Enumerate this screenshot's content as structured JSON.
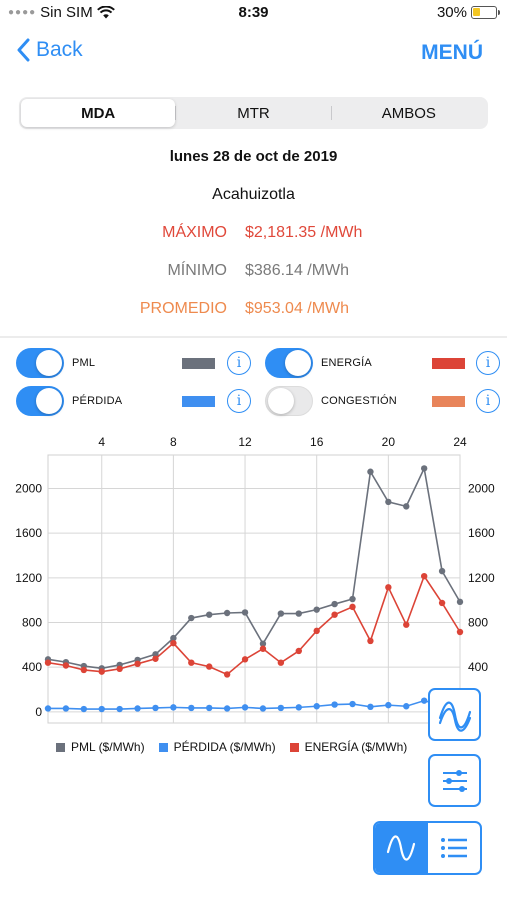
{
  "status_bar": {
    "carrier": "Sin SIM",
    "time": "8:39",
    "battery": "30%"
  },
  "nav": {
    "back_label": "Back",
    "menu_label": "MENÚ"
  },
  "segments": [
    {
      "label": "MDA",
      "active": true
    },
    {
      "label": "MTR",
      "active": false
    },
    {
      "label": "AMBOS",
      "active": false
    }
  ],
  "date": "lunes 28 de oct de 2019",
  "node": "Acahuizotla",
  "stats": {
    "max": {
      "label": "MÁXIMO",
      "value": "$2,181.35 /MWh"
    },
    "min": {
      "label": "MÍNIMO",
      "value": "$386.14 /MWh"
    },
    "avg": {
      "label": "PROMEDIO",
      "value": "$953.04 /MWh"
    }
  },
  "toggles": {
    "pml": {
      "label": "PML",
      "on": true,
      "color": "#6b717c"
    },
    "energia": {
      "label": "ENERGÍA",
      "on": true,
      "color": "#dc4437"
    },
    "perdida": {
      "label": "PÉRDIDA",
      "on": true,
      "color": "#3f8ff0"
    },
    "congestion": {
      "label": "CONGESTIÓN",
      "on": false,
      "color": "#e8845a"
    }
  },
  "icons": {
    "info": "info-icon",
    "wave_toggle": "wave-icon",
    "filters": "sliders-icon",
    "chart_mode": "wave-icon",
    "list_mode": "list-icon"
  },
  "chart_data": {
    "type": "line",
    "x": [
      1,
      2,
      3,
      4,
      5,
      6,
      7,
      8,
      9,
      10,
      11,
      12,
      13,
      14,
      15,
      16,
      17,
      18,
      19,
      20,
      21,
      22,
      23,
      24
    ],
    "x_ticks": [
      "4",
      "8",
      "12",
      "16",
      "20",
      "24"
    ],
    "y_ticks": [
      "0",
      "400",
      "800",
      "1200",
      "1600",
      "2000"
    ],
    "xlim": [
      1,
      24
    ],
    "ylim": [
      -100,
      2300
    ],
    "grid": true,
    "legend_position": "bottom",
    "series": [
      {
        "name": "PML ($/MWh)",
        "color": "#6b717c",
        "values": [
          470,
          445,
          410,
          390,
          420,
          465,
          515,
          660,
          840,
          870,
          885,
          890,
          610,
          880,
          880,
          915,
          965,
          1010,
          2150,
          1880,
          1840,
          2180,
          1260,
          985
        ]
      },
      {
        "name": "PÉRDIDA ($/MWh)",
        "color": "#3f8ff0",
        "values": [
          30,
          30,
          25,
          25,
          25,
          30,
          35,
          40,
          35,
          35,
          30,
          40,
          30,
          35,
          40,
          50,
          65,
          70,
          45,
          60,
          50,
          100,
          55,
          45
        ]
      },
      {
        "name": "ENERGÍA ($/MWh)",
        "color": "#dc4437",
        "values": [
          440,
          415,
          375,
          360,
          385,
          430,
          475,
          615,
          440,
          405,
          335,
          470,
          565,
          440,
          545,
          725,
          870,
          940,
          635,
          1115,
          780,
          1215,
          975,
          715
        ]
      }
    ]
  }
}
